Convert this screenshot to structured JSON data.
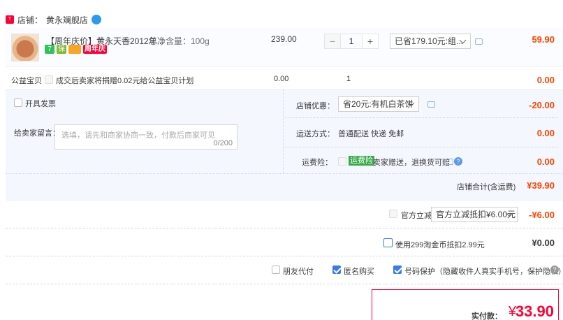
{
  "shop": {
    "label": "店铺：",
    "name": "黄永斓舰店",
    "logo": "T"
  },
  "item": {
    "title": "【周年庆价】黄永天香2012年...",
    "spec": "总净含量：100g",
    "badges": [
      "7",
      "保",
      "",
      "周年庆"
    ],
    "unit_price": "239.00",
    "quantity": "1",
    "minus": "−",
    "plus": "+",
    "discount_select": "已省179.10元:组...",
    "subtotal": "59.90"
  },
  "gongyi": {
    "label": "公益宝贝",
    "text": "成交后卖家将捐赠0.02元给公益宝贝计划",
    "price": "0.00",
    "qty": "1",
    "subtotal": "0.00"
  },
  "invoice": {
    "label": "开具发票"
  },
  "message": {
    "label": "给卖家留言：",
    "placeholder": "选填，请先和商家协商一致，付款后商家可见",
    "counter": "0/200"
  },
  "shop_discount": {
    "label": "店铺优惠：",
    "select": "省20元:有机白茶饼",
    "amount": "-20.00"
  },
  "delivery": {
    "label": "运送方式：",
    "value": "普通配送 快递 免邮",
    "amount": "0.00"
  },
  "freight_insurance": {
    "label": "运费险：",
    "tag": "运费险",
    "text": "卖家赠送，退换货可赔",
    "amount": "0.00"
  },
  "shop_total": {
    "label": "店铺合计(含运费)",
    "amount": "¥39.90"
  },
  "official_discount": {
    "label": "官方立减",
    "select": "官方立减抵扣¥6.00元",
    "amount": "-¥6.00"
  },
  "taojinbi": {
    "label": "使用299淘金币抵扣2.99元",
    "amount": "¥0.00"
  },
  "options": {
    "friend_pay": "朋友代付",
    "anonymous": "匿名购买",
    "number_protect": "号码保护（隐藏收件人真实手机号，保护隐私）"
  },
  "payment": {
    "label": "实付款：",
    "currency": "¥",
    "amount": "33.90"
  }
}
